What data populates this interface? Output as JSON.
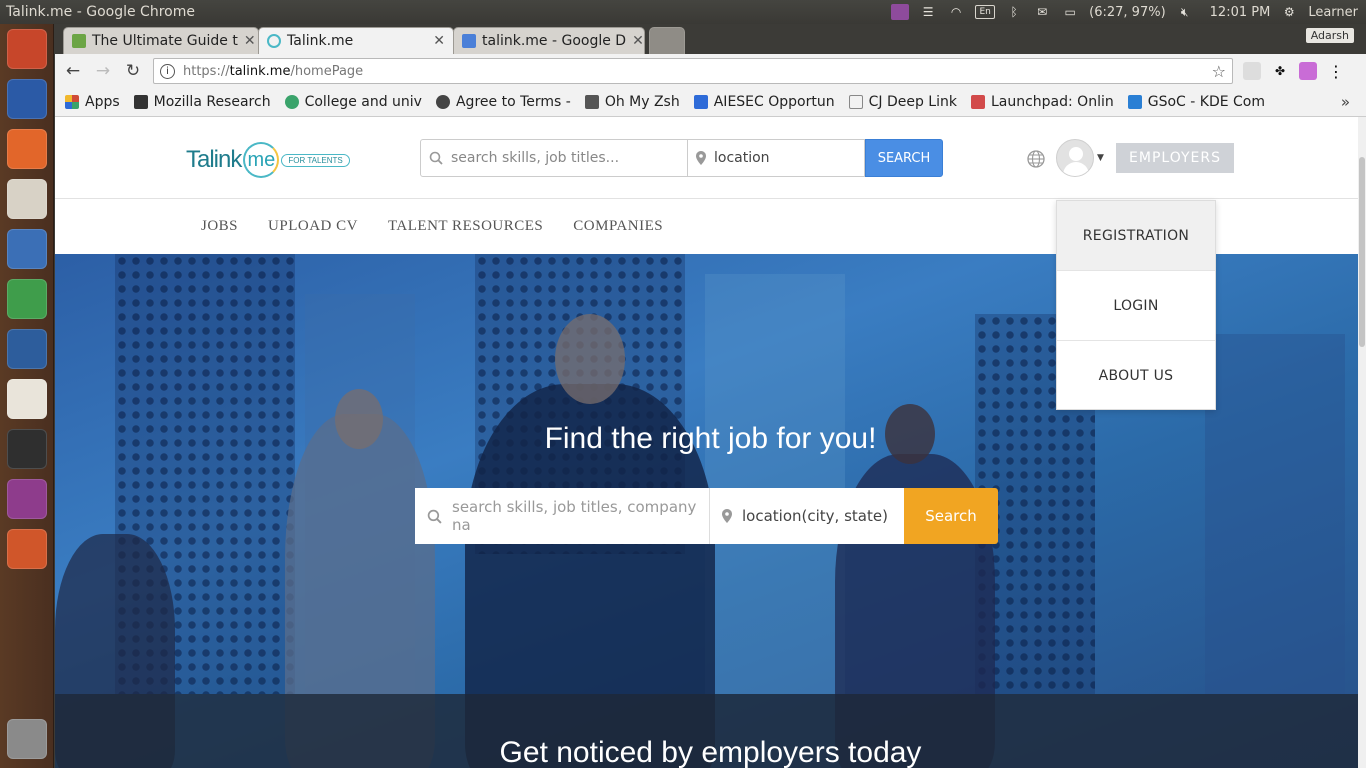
{
  "window": {
    "title": "Talink.me - Google Chrome"
  },
  "system_tray": {
    "keyboard_layout": "En",
    "battery": "(6:27, 97%)",
    "time": "12:01 PM",
    "user": "Learner"
  },
  "launcher": {
    "items": [
      {
        "name": "ubuntu-dash-icon",
        "color": "#c7462a"
      },
      {
        "name": "firefox-icon",
        "color": "#2b5aa6"
      },
      {
        "name": "software-center-icon",
        "color": "#e2662a"
      },
      {
        "name": "impress-icon",
        "color": "#d8d2c6"
      },
      {
        "name": "writer-icon",
        "color": "#3b6fb6"
      },
      {
        "name": "chrome-icon",
        "color": "#3f9d4b"
      },
      {
        "name": "thunderbird-icon",
        "color": "#2d5d9c"
      },
      {
        "name": "amazon-icon",
        "color": "#e9e4da"
      },
      {
        "name": "terminal-icon",
        "color": "#2f2f2f"
      },
      {
        "name": "workspaces-icon",
        "color": "#8e3c8c"
      },
      {
        "name": "xampp-icon",
        "color": "#d0562a"
      },
      {
        "name": "trash-icon",
        "color": "#8a8a8a"
      }
    ]
  },
  "tabs": [
    {
      "label": "The Ultimate Guide t",
      "active": false,
      "favicon": "#6ca545"
    },
    {
      "label": "Talink.me",
      "active": true,
      "favicon": "#4ab8c6"
    },
    {
      "label": "talink.me - Google D",
      "active": false,
      "favicon": "#4a7fd8"
    }
  ],
  "profile_chip": "Adarsh",
  "address_bar": {
    "scheme": "https://",
    "host": "talink.me",
    "path": "/homePage"
  },
  "bookmarks": [
    {
      "label": "Apps",
      "color": "#d04b38"
    },
    {
      "label": "Mozilla Research",
      "color": "#333333"
    },
    {
      "label": "College and univ",
      "color": "#3aa36b"
    },
    {
      "label": "Agree to Terms -",
      "color": "#444444"
    },
    {
      "label": "Oh My Zsh",
      "color": "#555555"
    },
    {
      "label": "AIESEC Opportun",
      "color": "#2e6bd8"
    },
    {
      "label": "CJ Deep Link",
      "color": "#dddddd"
    },
    {
      "label": "Launchpad: Onlin",
      "color": "#d24a4a"
    },
    {
      "label": "GSoC - KDE Com",
      "color": "#2a7fd4"
    }
  ],
  "site": {
    "logo": {
      "text": "Talink",
      "circle": "me",
      "tag": "FOR TALENTS"
    },
    "header_search": {
      "keyword_placeholder": "search skills, job titles...",
      "location_value": "location",
      "button": "SEARCH"
    },
    "employers_button": "EMPLOYERS",
    "nav": [
      "JOBS",
      "UPLOAD CV",
      "TALENT RESOURCES",
      "COMPANIES"
    ],
    "user_menu": [
      "REGISTRATION",
      "LOGIN",
      "ABOUT US"
    ],
    "hero": {
      "title": "Find the right job for you!",
      "keyword_placeholder": "search skills, job titles, company na",
      "location_value": "location(city, state)",
      "button": "Search"
    },
    "noticed_title": "Get noticed by employers today"
  }
}
